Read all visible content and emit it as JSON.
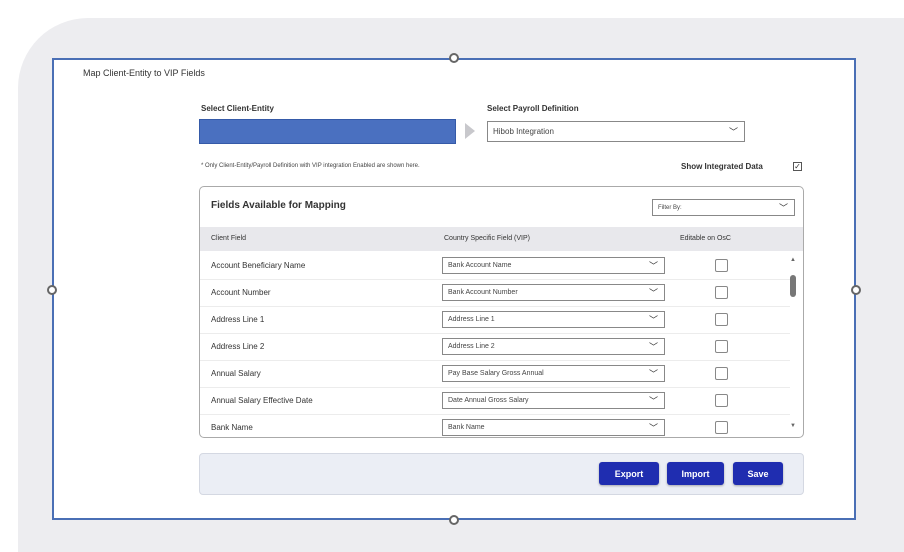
{
  "dialog": {
    "title": "Map Client-Entity to VIP Fields"
  },
  "client_entity": {
    "label": "Select Client-Entity",
    "value": ""
  },
  "payroll": {
    "label": "Select Payroll Definition",
    "value": "Hibob Integration"
  },
  "note": "* Only Client-Entity/Payroll Definition with VIP integration Enabled are shown here.",
  "show_integrated": {
    "label": "Show Integrated Data",
    "checked": true,
    "mark": "✓"
  },
  "fields_panel": {
    "title": "Fields Available for Mapping",
    "filter_placeholder": "Filter By:",
    "columns": [
      "Client Field",
      "Country Specific Field (VIP)",
      "Editable on OsC"
    ],
    "rows": [
      {
        "client_field": "Account Beneficiary Name",
        "vip_field": "Bank Account Name"
      },
      {
        "client_field": "Account Number",
        "vip_field": "Bank Account Number"
      },
      {
        "client_field": "Address Line 1",
        "vip_field": "Address Line 1"
      },
      {
        "client_field": "Address Line 2",
        "vip_field": "Address Line 2"
      },
      {
        "client_field": "Annual Salary",
        "vip_field": "Pay Base Salary Gross Annual"
      },
      {
        "client_field": "Annual Salary Effective Date",
        "vip_field": "Date Annual Gross Salary"
      },
      {
        "client_field": "Bank Name",
        "vip_field": "Bank Name"
      }
    ]
  },
  "buttons": {
    "export": "Export",
    "import": "Import",
    "save": "Save"
  },
  "colors": {
    "primary_button": "#1f2db0",
    "selected_entity": "#4a70c0",
    "border_accent": "#4a6fb5"
  },
  "icons": {
    "dropdown": "chevron-down-icon",
    "separator": "arrow-right-icon"
  }
}
